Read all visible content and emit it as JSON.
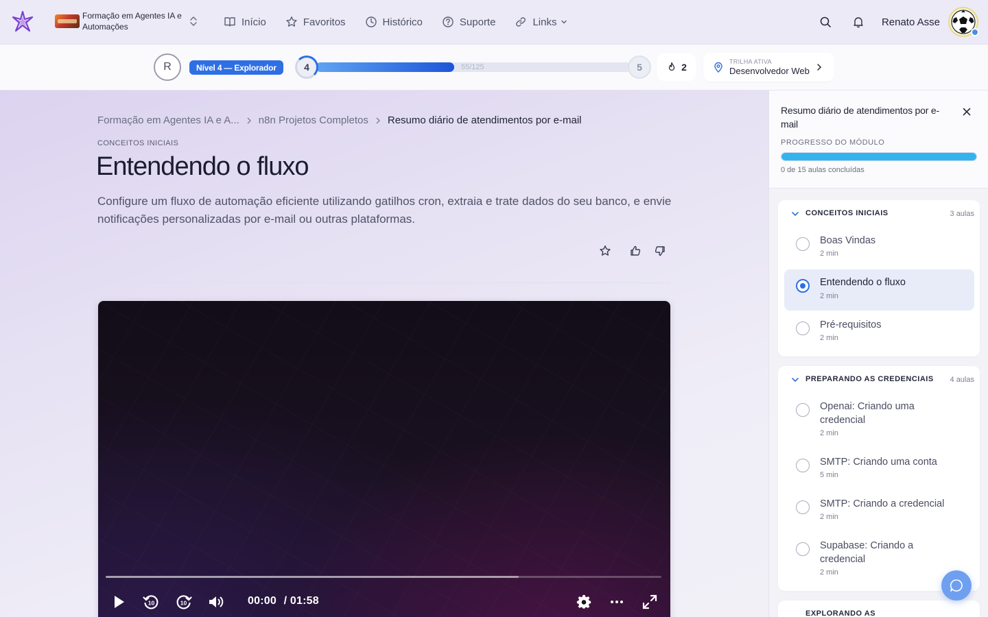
{
  "header": {
    "course_name": "Formação em Agentes IA e Automações",
    "nav": [
      {
        "label": "Início",
        "icon": "book-icon"
      },
      {
        "label": "Favoritos",
        "icon": "star-icon"
      },
      {
        "label": "Histórico",
        "icon": "clock-icon"
      },
      {
        "label": "Suporte",
        "icon": "help-icon"
      },
      {
        "label": "Links",
        "icon": "link-icon"
      }
    ],
    "user_name": "Renato Asse"
  },
  "progress": {
    "user_initial": "R",
    "level_badge": "Nível 4 — Explorador",
    "current_level": "4",
    "next_level": "5",
    "xp_text": "55/125",
    "xp_fraction": 0.44,
    "streak": "2",
    "trail_label": "TRILHA ATIVA",
    "trail_value": "Desenvolvedor Web"
  },
  "breadcrumb": {
    "item1": "Formação em Agentes IA e A...",
    "item2": "n8n Projetos Completos",
    "current": "Resumo diário de atendimentos por e-mail"
  },
  "lesson": {
    "section": "CONCEITOS INICIAIS",
    "title": "Entendendo o fluxo",
    "description": "Configure um fluxo de automação eficiente utilizando gatilhos cron, extraia e trate dados do seu banco, e envie notificações personalizadas por e-mail ou outras plataformas."
  },
  "video": {
    "current_time": "00:00",
    "duration": "/ 01:58",
    "buffered_fraction": 0.743,
    "skip_seconds": "10"
  },
  "sidebar": {
    "title": "Resumo diário de atendimentos por e-mail",
    "progress_label": "PROGRESSO DO MÓDULO",
    "progress_fraction": 1.0,
    "progress_count": "0 de 15 aulas concluídas",
    "modules": [
      {
        "name": "CONCEITOS INICIAIS",
        "count": "3 aulas",
        "lessons": [
          {
            "name": "Boas Vindas",
            "duration": "2 min"
          },
          {
            "name": "Entendendo o fluxo",
            "duration": "2 min"
          },
          {
            "name": "Pré-requisitos",
            "duration": "2 min"
          }
        ]
      },
      {
        "name": "PREPARANDO AS CREDENCIAIS",
        "count": "4 aulas",
        "lessons": [
          {
            "name": "Openai: Criando uma credencial",
            "duration": "2 min"
          },
          {
            "name": "SMTP: Criando uma conta",
            "duration": "5 min"
          },
          {
            "name": "SMTP: Criando a credencial",
            "duration": "2 min"
          },
          {
            "name": "Supabase: Criando a credencial",
            "duration": "2 min"
          }
        ]
      },
      {
        "name": "EXPLORANDO AS",
        "count": ""
      }
    ]
  },
  "colors": {
    "accent": "#2f6fe4",
    "module_progress": "#35b3ec",
    "chat_button": "#6ea0ef"
  }
}
